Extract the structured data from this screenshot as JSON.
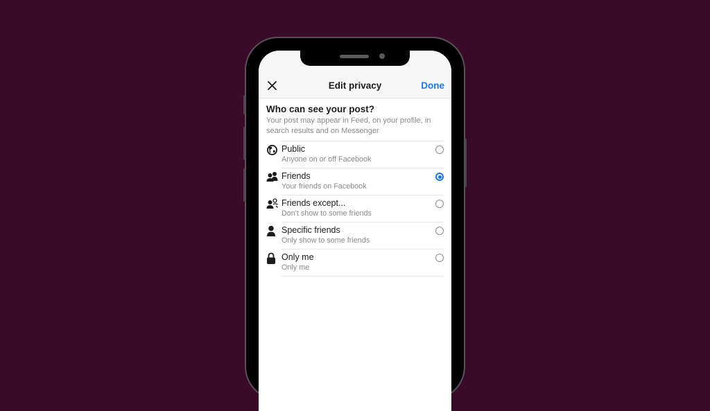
{
  "colors": {
    "background": "#3a0b29",
    "accent": "#1877f2"
  },
  "header": {
    "close_icon": "close-icon",
    "title": "Edit privacy",
    "done_label": "Done"
  },
  "question": {
    "title": "Who can see your post?",
    "subtitle": "Your post may appear in Feed, on your profile, in search results and on Messenger"
  },
  "options": [
    {
      "icon": "globe-icon",
      "label": "Public",
      "description": "Anyone on or off Facebook",
      "selected": false
    },
    {
      "icon": "friends-icon",
      "label": "Friends",
      "description": "Your friends on Facebook",
      "selected": true
    },
    {
      "icon": "friends-except-icon",
      "label": "Friends except...",
      "description": "Don't show to some friends",
      "selected": false
    },
    {
      "icon": "person-icon",
      "label": "Specific friends",
      "description": "Only show to some friends",
      "selected": false
    },
    {
      "icon": "lock-icon",
      "label": "Only me",
      "description": "Only me",
      "selected": false
    }
  ]
}
